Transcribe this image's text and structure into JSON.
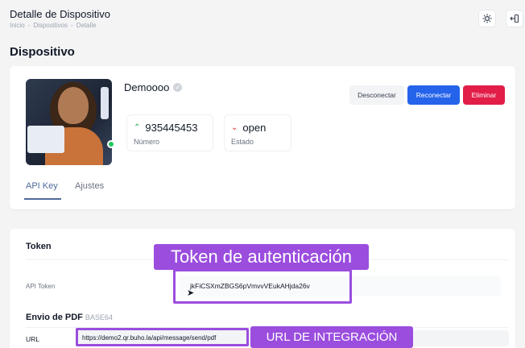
{
  "header": {
    "title": "Detalle de Dispositivo",
    "breadcrumb": [
      "Inicio",
      "-",
      "Dispositivos",
      "-",
      "Detalle"
    ]
  },
  "section_title": "Dispositivo",
  "device": {
    "name": "Demoooo",
    "number_value": "935445453",
    "number_label": "Número",
    "state_value": "open",
    "state_label": "Estado"
  },
  "actions": {
    "disconnect": "Desconectar",
    "reconnect": "Reconectar",
    "delete": "Eliminar"
  },
  "tabs": [
    {
      "label": "API Key",
      "active": true
    },
    {
      "label": "Ajustes",
      "active": false
    }
  ],
  "token_section": {
    "title": "Token",
    "api_label": "API Token",
    "api_value": "jkFiCSXmZBGS6pVmvvVEukAHjda26v"
  },
  "pdf_section": {
    "title": "Envio de PDF",
    "subtitle": "BASE64",
    "url_label": "URL",
    "url_value": "https://demo2.qr.buho.la/api/message/send/pdf"
  },
  "annotations": {
    "token": "Token de autenticación",
    "url": "URL DE INTEGRACIÓN"
  },
  "colors": {
    "primary": "#2563eb",
    "danger": "#e11d48",
    "annotation": "#9b4dde",
    "online": "#22c55e"
  }
}
